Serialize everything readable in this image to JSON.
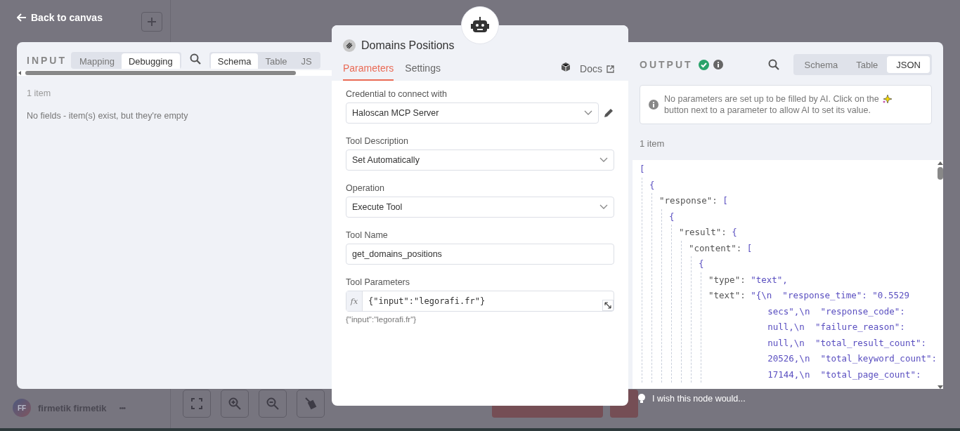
{
  "back_link": "Back to canvas",
  "sidebar": {
    "user": {
      "initials": "FF",
      "name": "firmetik firmetik",
      "menu": "•••"
    }
  },
  "input": {
    "title": "INPUT",
    "mode_tabs": [
      {
        "label": "Mapping",
        "selected": false
      },
      {
        "label": "Debugging",
        "selected": true
      }
    ],
    "view_tabs": [
      {
        "label": "Schema",
        "selected": true
      },
      {
        "label": "Table",
        "selected": false
      },
      {
        "label": "JS",
        "selected": false
      }
    ],
    "item_count": "1 item",
    "message": "No fields - item(s) exist, but they're empty"
  },
  "node": {
    "title": "Domains Positions",
    "tabs": [
      {
        "label": "Parameters",
        "selected": true
      },
      {
        "label": "Settings",
        "selected": false
      }
    ],
    "docs": "Docs",
    "fields": [
      {
        "kind": "credential",
        "label": "Credential to connect with",
        "value": "Haloscan MCP Server"
      },
      {
        "kind": "select",
        "label": "Tool Description",
        "value": "Set Automatically"
      },
      {
        "kind": "select",
        "label": "Operation",
        "value": "Execute Tool"
      },
      {
        "kind": "input",
        "label": "Tool Name",
        "value": "get_domains_positions"
      },
      {
        "kind": "expression",
        "label": "Tool Parameters",
        "prefix": "fx",
        "value": "{\"input\":\"legorafi.fr\"}",
        "hint": "{\"input\":\"legorafi.fr\"}"
      }
    ]
  },
  "output": {
    "title": "OUTPUT",
    "succeeded": true,
    "view_tabs": [
      {
        "label": "Schema",
        "selected": false
      },
      {
        "label": "Table",
        "selected": false
      },
      {
        "label": "JSON",
        "selected": true
      }
    ],
    "notice": [
      "No parameters are set up to be filled by AI. Click on the",
      "button next to a parameter to allow AI to set its value."
    ],
    "item_count": "1 item",
    "json": [
      {
        "bracket": "[",
        "children": [
          {
            "bracket": "{",
            "children": [
              {
                "key": "\"response\":",
                "bracket": "[",
                "children": [
                  {
                    "bracket": "{",
                    "children": [
                      {
                        "key": "\"result\":",
                        "bracket": "{",
                        "children": [
                          {
                            "key": "\"content\":",
                            "bracket": "[",
                            "children": [
                              {
                                "bracket": "{",
                                "children": [
                                  {
                                    "key": "\"type\":",
                                    "value": [
                                      "\"text\","
                                    ]
                                  },
                                  {
                                    "key": "\"text\":",
                                    "value": [
                                      "\"{\\n  \"response_time\": \"0.5529",
                                      "secs\",\\n  \"response_code\":",
                                      "null,\\n  \"failure_reason\":",
                                      "null,\\n  \"total_result_count\":",
                                      "20526,\\n  \"total_keyword_count\":",
                                      "17144,\\n  \"total_page_count\":"
                                    ]
                                  }
                                ]
                              }
                            ]
                          }
                        ]
                      }
                    ]
                  }
                ]
              }
            ]
          }
        ]
      }
    ]
  },
  "feedback": "I wish this node would..."
}
